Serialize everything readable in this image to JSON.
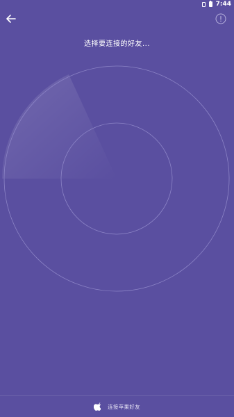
{
  "status_bar": {
    "time": "7:44",
    "icons": [
      "sim-icon",
      "battery-icon"
    ]
  },
  "header": {
    "back_icon": "back-arrow-icon",
    "info_icon": "info-icon",
    "title": "选择要连接的好友..."
  },
  "radar": {
    "sweep_color": "#7268b4",
    "ring_color": "#8c84c6"
  },
  "bottom_bar": {
    "icon": "apple-icon",
    "label": "连接苹果好友"
  },
  "colors": {
    "background": "#5a4fa0"
  }
}
